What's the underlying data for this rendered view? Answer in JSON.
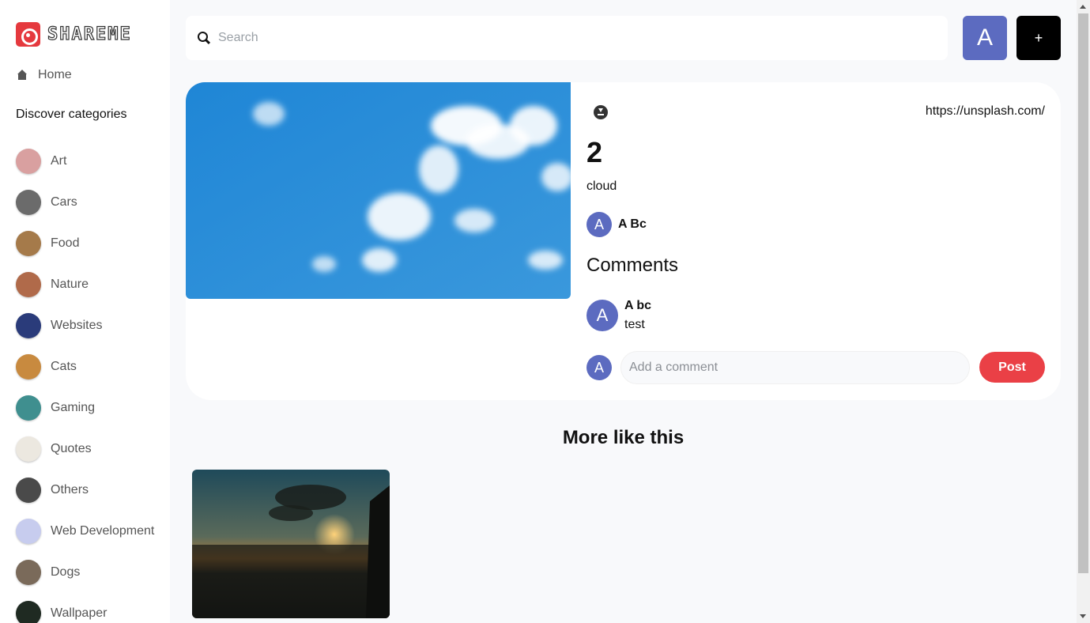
{
  "brand": {
    "name": "SHAREME"
  },
  "sidebar": {
    "home_label": "Home",
    "discover_label": "Discover categories",
    "categories": [
      {
        "label": "Art",
        "color": "#d9a0a0"
      },
      {
        "label": "Cars",
        "color": "#6b6b6b"
      },
      {
        "label": "Food",
        "color": "#a57a4a"
      },
      {
        "label": "Nature",
        "color": "#b06a4a"
      },
      {
        "label": "Websites",
        "color": "#2a3b7a"
      },
      {
        "label": "Cats",
        "color": "#c88a3f"
      },
      {
        "label": "Gaming",
        "color": "#3f8f8f"
      },
      {
        "label": "Quotes",
        "color": "#ece8e0"
      },
      {
        "label": "Others",
        "color": "#4a4a4a"
      },
      {
        "label": "Web Development",
        "color": "#c7ccee"
      },
      {
        "label": "Dogs",
        "color": "#7a6a5a"
      },
      {
        "label": "Wallpaper",
        "color": "#1f2a22"
      }
    ]
  },
  "topbar": {
    "search_placeholder": "Search",
    "search_value": "",
    "user_initial": "A",
    "add_label": "+"
  },
  "pin": {
    "source_url": "https://unsplash.com/",
    "title": "2",
    "about": "cloud",
    "author_initial": "A",
    "author_name": "A Bc",
    "comments_heading": "Comments",
    "comments": [
      {
        "initial": "A",
        "user": "A bc",
        "text": "test"
      }
    ],
    "comment_placeholder": "Add a comment",
    "my_initial": "A",
    "post_label": "Post"
  },
  "more": {
    "heading": "More like this"
  },
  "colors": {
    "accent": "#5c6bc0",
    "post": "#ea4046",
    "background": "#f8f9fb"
  }
}
